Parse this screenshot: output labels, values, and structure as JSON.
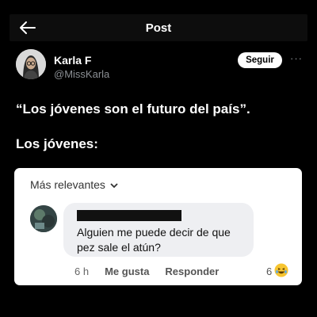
{
  "header": {
    "title": "Post",
    "back_icon": "arrow-left-icon"
  },
  "author": {
    "name": "Karla F",
    "handle": "@MissKarla",
    "follow_label": "Seguir",
    "more_label": "···"
  },
  "post": {
    "line1": "“Los jóvenes son el futuro del país”.",
    "line2": "Los jóvenes:"
  },
  "comment_card": {
    "sort_label": "Más relevantes",
    "comment_text": "Alguien me puede decir de que pez sale el atún?",
    "time": "6 h",
    "like_label": "Me gusta",
    "reply_label": "Responder",
    "reaction_count": "6",
    "reaction_icon": "laughing-emoji-icon"
  },
  "colors": {
    "background": "#000000",
    "card": "#ffffff",
    "bubble": "#eeeff2",
    "muted": "#8b8f94"
  }
}
